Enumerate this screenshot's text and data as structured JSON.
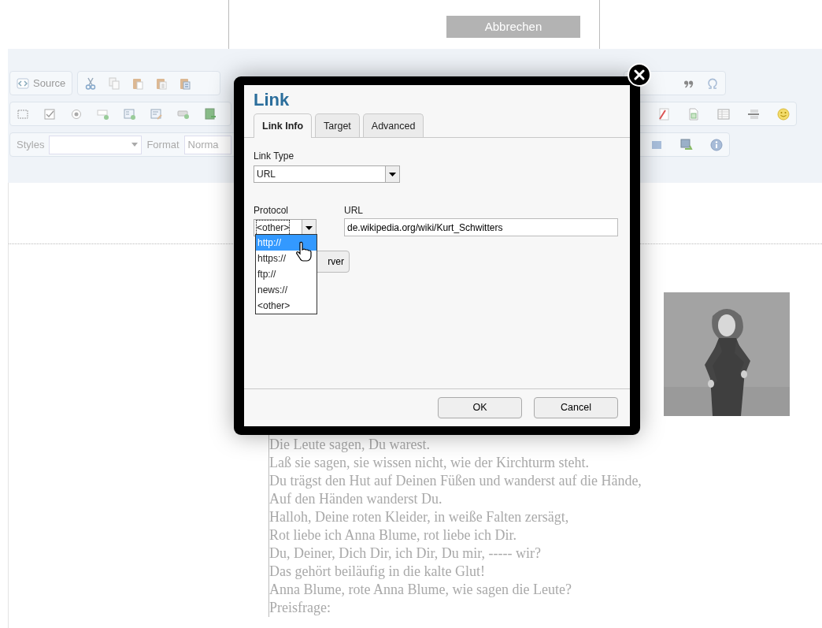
{
  "top_bar": {
    "cancel_button": "Abbrechen"
  },
  "toolbar": {
    "source_button": "Source",
    "styles_label": "Styles",
    "format_label": "Format",
    "format_value": "Norma"
  },
  "content": {
    "poem_lines": [
      "Die Leute sagen, Du warest.",
      "Laß sie sagen, sie wissen nicht, wie der Kirchturm steht.",
      "Du trägst den Hut auf Deinen Füßen und wanderst auf die Hände,",
      "Auf den Händen wanderst Du.",
      "Halloh, Deine roten Kleider, in weiße Falten zersägt,",
      "Rot liebe ich Anna Blume, rot liebe ich Dir.",
      "Du, Deiner, Dich Dir, ich Dir, Du mir, ----- wir?",
      "Das gehört beiläufig in die kalte Glut!",
      "Anna Blume, rote Anna Blume, wie sagen die Leute?",
      "Preisfrage:"
    ]
  },
  "dialog": {
    "title": "Link",
    "tabs": [
      {
        "label": "Link Info",
        "selected": true
      },
      {
        "label": "Target",
        "selected": false
      },
      {
        "label": "Advanced",
        "selected": false
      }
    ],
    "link_type_label": "Link Type",
    "link_type_value": "URL",
    "protocol_label": "Protocol",
    "protocol_value": "<other>",
    "url_label": "URL",
    "url_value": "de.wikipedia.org/wiki/Kurt_Schwitters",
    "protocol_options": [
      {
        "label": "http://",
        "selected": true
      },
      {
        "label": "https://",
        "selected": false
      },
      {
        "label": "ftp://",
        "selected": false
      },
      {
        "label": "news://",
        "selected": false
      },
      {
        "label": "<other>",
        "selected": false
      }
    ],
    "browse_button": "rver",
    "buttons": [
      "OK",
      "Cancel"
    ]
  }
}
